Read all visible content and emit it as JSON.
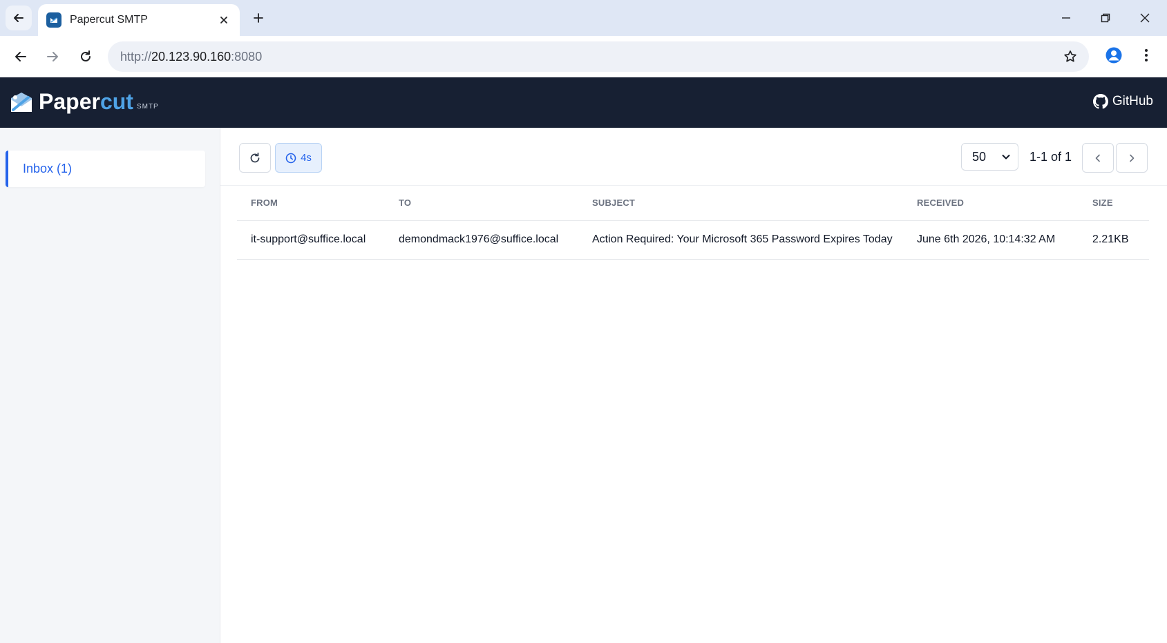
{
  "browser": {
    "tab_title": "Papercut SMTP",
    "url_scheme": "http://",
    "url_host": "20.123.90.160",
    "url_port": ":8080"
  },
  "app": {
    "logo_paper": "Paper",
    "logo_cut": "cut",
    "logo_smtp": "SMTP",
    "github_label": "GitHub"
  },
  "sidebar": {
    "inbox_label": "Inbox (1)"
  },
  "toolbar": {
    "auto_refresh_label": "4s",
    "page_size": "50",
    "page_range": "1-1 of 1"
  },
  "table": {
    "headers": {
      "from": "FROM",
      "to": "TO",
      "subject": "SUBJECT",
      "received": "RECEIVED",
      "size": "SIZE"
    },
    "rows": [
      {
        "from": "it-support@suffice.local",
        "to": "demondmack1976@suffice.local",
        "subject": "Action Required: Your Microsoft 365 Password Expires Today",
        "received": "June 6th 2026, 10:14:32 AM",
        "size": "2.21KB"
      }
    ]
  },
  "colors": {
    "header_bg": "#172033",
    "accent": "#2563eb",
    "logo_cut": "#4fa3e6"
  }
}
